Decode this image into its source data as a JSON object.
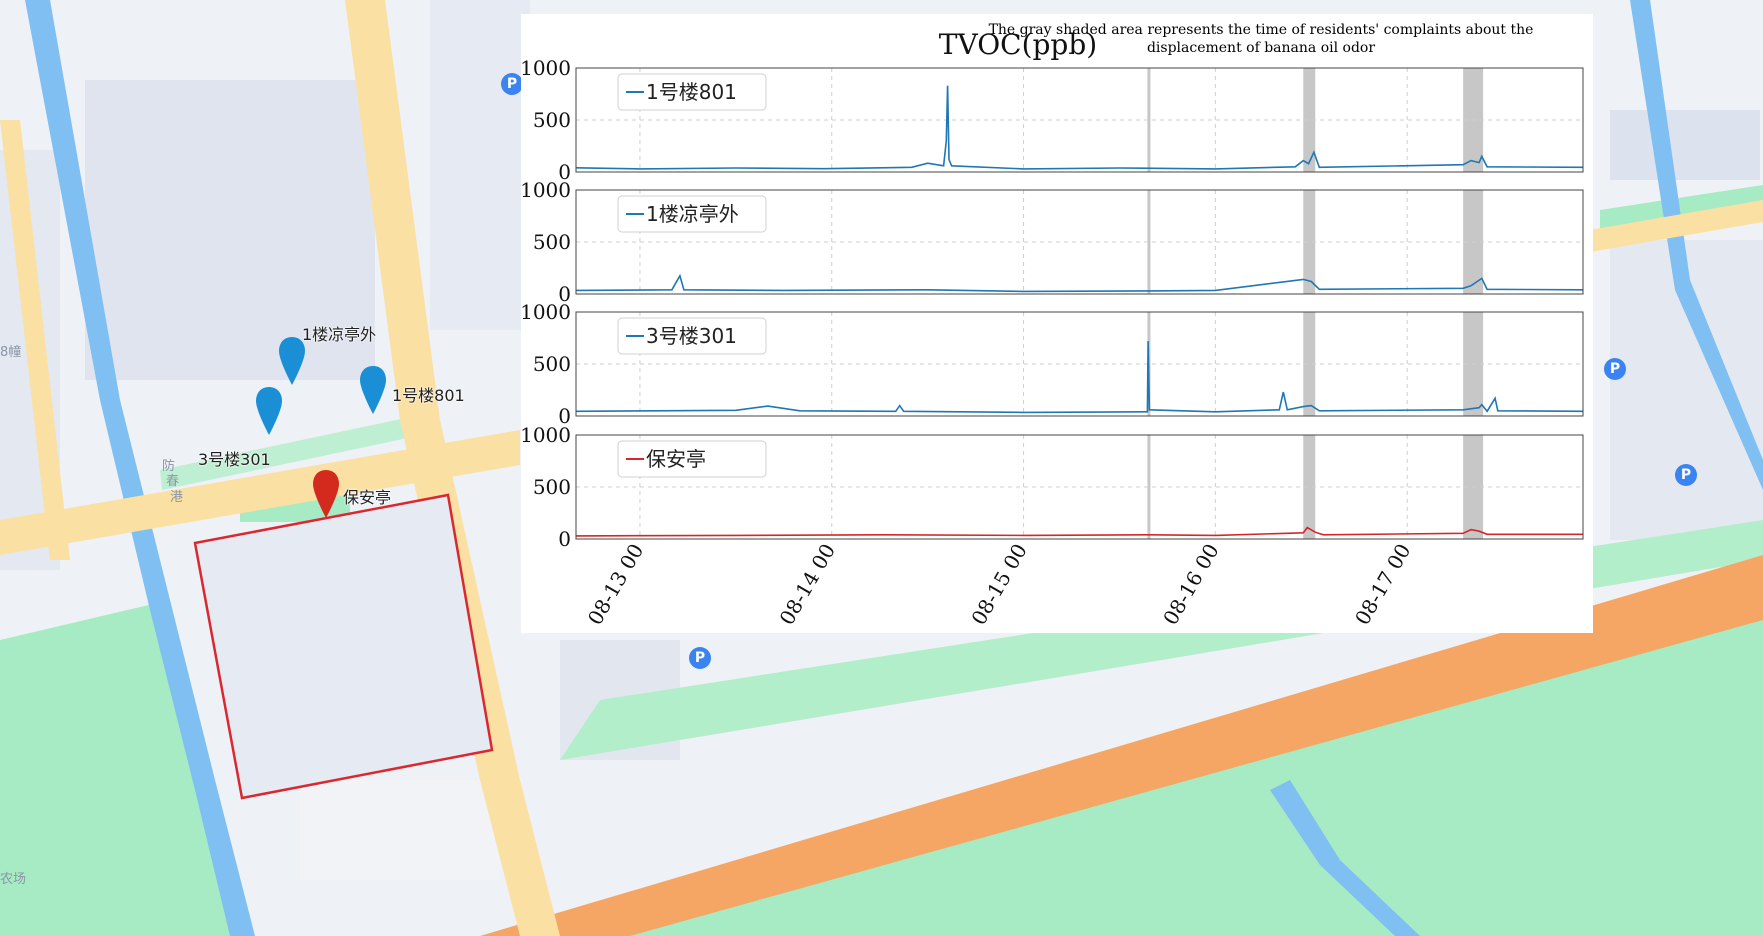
{
  "map": {
    "markers": [
      {
        "label": "1楼凉亭外",
        "color": "#1b8fd6"
      },
      {
        "label": "1号楼801",
        "color": "#1b8fd6"
      },
      {
        "label": "3号楼301",
        "color": "#1b8fd6"
      },
      {
        "label": "保安亭",
        "color": "#d42a1e"
      }
    ],
    "street_labels": [
      "8幢",
      "防",
      "春",
      "港",
      "农场"
    ],
    "parking_icon": "P",
    "colors": {
      "road_major": "#fbe0a3",
      "road_expressway": "#f5a665",
      "water": "#7fbff2",
      "green": "#a7ebc4",
      "block": "#dde3ee",
      "site_outline": "#d9282f"
    }
  },
  "chart_data": {
    "type": "line",
    "title": "TVOC(ppb)",
    "annotation": "The gray shaded area represents the time of residents' complaints about the displacement of banana oil odor",
    "x_type": "datetime",
    "xlim": [
      "08-12 16:00",
      "08-17 22:00"
    ],
    "x_ticks": [
      "08-13 00",
      "08-14 00",
      "08-15 00",
      "08-16 00",
      "08-17 00"
    ],
    "ylim": [
      0,
      1000
    ],
    "y_ticks": [
      "0",
      "500",
      "1000"
    ],
    "grid": true,
    "shaded_periods": [
      {
        "start": "08-15 15:30",
        "end": "08-15 15:45"
      },
      {
        "start": "08-16 11:00",
        "end": "08-16 12:30"
      },
      {
        "start": "08-17 07:00",
        "end": "08-17 09:30"
      }
    ],
    "panels": [
      {
        "series_name": "1号楼801",
        "color": "#1f77b4",
        "baseline": 35,
        "points": [
          [
            "08-12 16:00",
            40
          ],
          [
            "08-13 00:00",
            30
          ],
          [
            "08-13 12:00",
            38
          ],
          [
            "08-13 23:00",
            32
          ],
          [
            "08-14 10:00",
            45
          ],
          [
            "08-14 12:00",
            85
          ],
          [
            "08-14 14:00",
            60
          ],
          [
            "08-14 14:20",
            300
          ],
          [
            "08-14 14:30",
            830
          ],
          [
            "08-14 14:40",
            120
          ],
          [
            "08-14 15:00",
            60
          ],
          [
            "08-15 00:00",
            30
          ],
          [
            "08-15 12:00",
            38
          ],
          [
            "08-16 00:00",
            30
          ],
          [
            "08-16 10:00",
            50
          ],
          [
            "08-16 11:00",
            110
          ],
          [
            "08-16 11:40",
            80
          ],
          [
            "08-16 12:20",
            190
          ],
          [
            "08-16 13:00",
            45
          ],
          [
            "08-17 07:00",
            70
          ],
          [
            "08-17 08:00",
            110
          ],
          [
            "08-17 09:00",
            90
          ],
          [
            "08-17 09:20",
            150
          ],
          [
            "08-17 10:00",
            50
          ],
          [
            "08-17 22:00",
            45
          ]
        ]
      },
      {
        "series_name": "1楼凉亭外",
        "color": "#1f77b4",
        "baseline": 30,
        "points": [
          [
            "08-12 16:00",
            35
          ],
          [
            "08-13 04:00",
            40
          ],
          [
            "08-13 05:00",
            175
          ],
          [
            "08-13 05:30",
            40
          ],
          [
            "08-13 18:00",
            35
          ],
          [
            "08-14 12:00",
            40
          ],
          [
            "08-15 00:00",
            25
          ],
          [
            "08-15 16:00",
            30
          ],
          [
            "08-16 00:00",
            35
          ],
          [
            "08-16 11:00",
            140
          ],
          [
            "08-16 12:00",
            120
          ],
          [
            "08-16 13:00",
            45
          ],
          [
            "08-17 07:00",
            55
          ],
          [
            "08-17 08:00",
            80
          ],
          [
            "08-17 09:20",
            150
          ],
          [
            "08-17 10:00",
            45
          ],
          [
            "08-17 22:00",
            40
          ]
        ]
      },
      {
        "series_name": "3号楼301",
        "color": "#1f77b4",
        "baseline": 40,
        "points": [
          [
            "08-12 16:00",
            45
          ],
          [
            "08-13 12:00",
            55
          ],
          [
            "08-13 16:00",
            95
          ],
          [
            "08-13 20:00",
            50
          ],
          [
            "08-14 08:00",
            45
          ],
          [
            "08-14 08:30",
            100
          ],
          [
            "08-14 09:00",
            45
          ],
          [
            "08-15 00:00",
            35
          ],
          [
            "08-15 15:30",
            40
          ],
          [
            "08-15 15:35",
            720
          ],
          [
            "08-15 15:45",
            60
          ],
          [
            "08-16 00:00",
            40
          ],
          [
            "08-16 08:00",
            60
          ],
          [
            "08-16 08:30",
            230
          ],
          [
            "08-16 09:00",
            60
          ],
          [
            "08-16 11:00",
            90
          ],
          [
            "08-16 12:00",
            100
          ],
          [
            "08-16 13:00",
            50
          ],
          [
            "08-17 07:00",
            60
          ],
          [
            "08-17 09:00",
            80
          ],
          [
            "08-17 09:20",
            110
          ],
          [
            "08-17 10:00",
            45
          ],
          [
            "08-17 11:00",
            170
          ],
          [
            "08-17 11:20",
            50
          ],
          [
            "08-17 22:00",
            45
          ]
        ]
      },
      {
        "series_name": "保安亭",
        "color": "#d62728",
        "baseline": 35,
        "points": [
          [
            "08-12 16:00",
            30
          ],
          [
            "08-13 12:00",
            35
          ],
          [
            "08-14 06:00",
            40
          ],
          [
            "08-15 00:00",
            35
          ],
          [
            "08-15 16:00",
            40
          ],
          [
            "08-16 00:00",
            35
          ],
          [
            "08-16 11:00",
            60
          ],
          [
            "08-16 11:30",
            110
          ],
          [
            "08-16 12:30",
            65
          ],
          [
            "08-16 13:30",
            40
          ],
          [
            "08-17 07:00",
            55
          ],
          [
            "08-17 08:00",
            90
          ],
          [
            "08-17 09:00",
            75
          ],
          [
            "08-17 10:00",
            45
          ],
          [
            "08-17 22:00",
            45
          ]
        ]
      }
    ]
  }
}
